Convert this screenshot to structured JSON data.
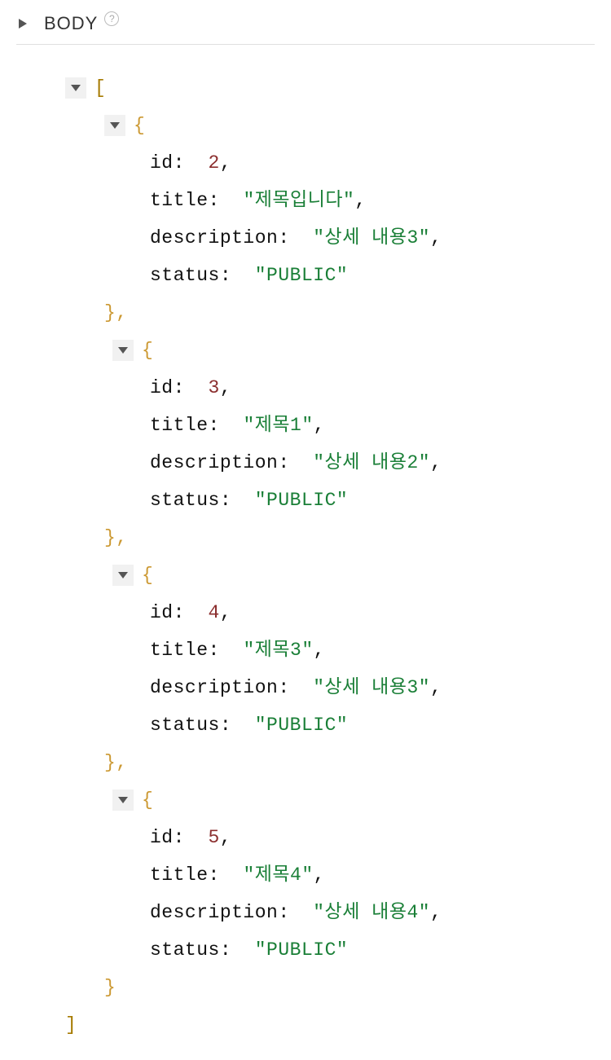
{
  "header": {
    "label": "BODY",
    "help": "?"
  },
  "json": {
    "open_bracket": "[",
    "close_bracket": "]",
    "open_brace": "{",
    "close_brace": "}",
    "close_brace_comma": "},",
    "comma": ",",
    "keys": {
      "id": "id",
      "title": "title",
      "description": "description",
      "status": "status"
    },
    "items": [
      {
        "id": "2",
        "title": "\"제목입니다\"",
        "description": "\"상세 내용3\"",
        "status": "\"PUBLIC\""
      },
      {
        "id": "3",
        "title": "\"제목1\"",
        "description": "\"상세 내용2\"",
        "status": "\"PUBLIC\""
      },
      {
        "id": "4",
        "title": "\"제목3\"",
        "description": "\"상세 내용3\"",
        "status": "\"PUBLIC\""
      },
      {
        "id": "5",
        "title": "\"제목4\"",
        "description": "\"상세 내용4\"",
        "status": "\"PUBLIC\""
      }
    ]
  }
}
